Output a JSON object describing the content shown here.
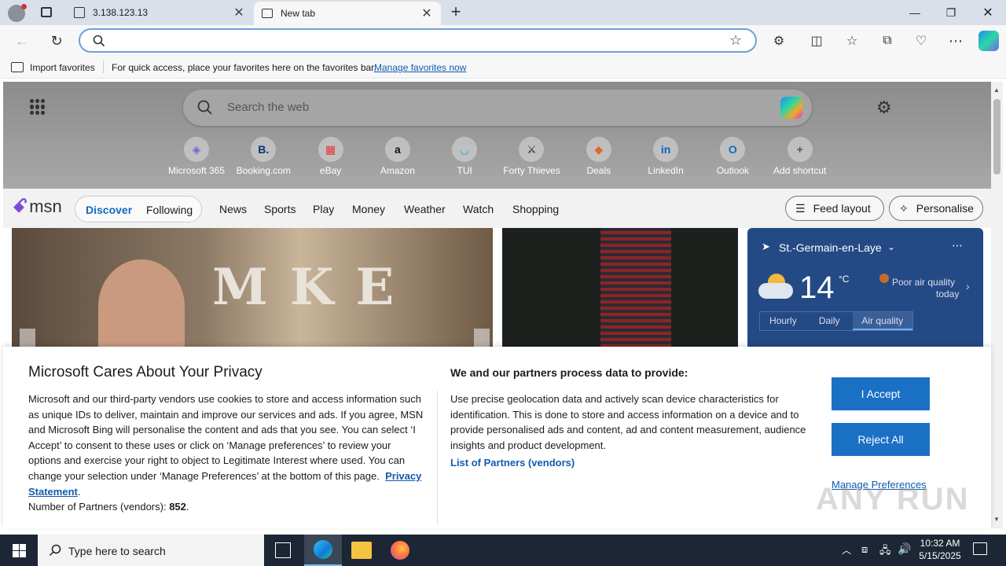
{
  "tabs": [
    {
      "title": "3.138.123.13",
      "icon": "page-icon"
    },
    {
      "title": "New tab",
      "icon": "newtab-icon"
    }
  ],
  "favorites_bar": {
    "import_label": "Import favorites",
    "message": "For quick access, place your favorites here on the favorites bar.",
    "manage_link": "Manage favorites now"
  },
  "address_bar": {
    "value": "",
    "placeholder": ""
  },
  "msn": {
    "search_placeholder": "Search the web",
    "shortcuts": [
      {
        "label": "Microsoft 365",
        "glyph": "◈",
        "color": "#7b5cd6"
      },
      {
        "label": "Booking.com",
        "glyph": "B.",
        "color": "#003580"
      },
      {
        "label": "eBay",
        "glyph": "▦",
        "color": "#e53238"
      },
      {
        "label": "Amazon",
        "glyph": "a",
        "color": "#111111"
      },
      {
        "label": "TUI",
        "glyph": "◡",
        "color": "#1b9de2"
      },
      {
        "label": "Forty Thieves",
        "glyph": "⚔",
        "color": "#222222"
      },
      {
        "label": "Deals",
        "glyph": "◆",
        "color": "#e0692a"
      },
      {
        "label": "LinkedIn",
        "glyph": "in",
        "color": "#0a66c2"
      },
      {
        "label": "Outlook",
        "glyph": "O",
        "color": "#0f6cbd"
      },
      {
        "label": "Add shortcut",
        "glyph": "+",
        "color": "#555555"
      }
    ],
    "logo_text": "msn",
    "nav": [
      "Discover",
      "Following",
      "News",
      "Sports",
      "Play",
      "Money",
      "Weather",
      "Watch",
      "Shopping"
    ],
    "feed_layout": "Feed layout",
    "personalise": "Personalise",
    "weather": {
      "location": "St.-Germain-en-Laye",
      "temp": "14",
      "unit": "°C",
      "air_quality_line1": "Poor air quality",
      "air_quality_line2": "today",
      "tabs": [
        "Hourly",
        "Daily",
        "Air quality"
      ]
    }
  },
  "privacy": {
    "title": "Microsoft Cares About Your Privacy",
    "body": "Microsoft and our third-party vendors use cookies to store and access information such as unique IDs to deliver, maintain and improve our services and ads. If you agree, MSN and Microsoft Bing will personalise the content and ads that you see. You can select ‘I Accept’ to consent to these uses or click on ‘Manage preferences’ to review your options and exercise your right to object to Legitimate Interest where used.  You can change your selection under ‘Manage Preferences’ at the bottom of this page.",
    "privacy_link": "Privacy Statement",
    "partners_label": "Number of Partners (vendors):",
    "partners_count": "852",
    "right_title": "We and our partners process data to provide:",
    "right_body": "Use precise geolocation data and actively scan device characteristics for identification. This is done to store and access information on a device and to provide personalised ads and content, ad and content measurement, audience insights and product development.",
    "partners_link": "List of Partners (vendors)",
    "accept": "I Accept",
    "reject": "Reject All",
    "manage": "Manage Preferences"
  },
  "taskbar": {
    "search_placeholder": "Type here to search",
    "time": "10:32 AM",
    "date": "5/15/2025"
  },
  "watermark": "ANY RUN",
  "colors": {
    "accent": "#1a70c4",
    "link": "#0f5cad"
  }
}
